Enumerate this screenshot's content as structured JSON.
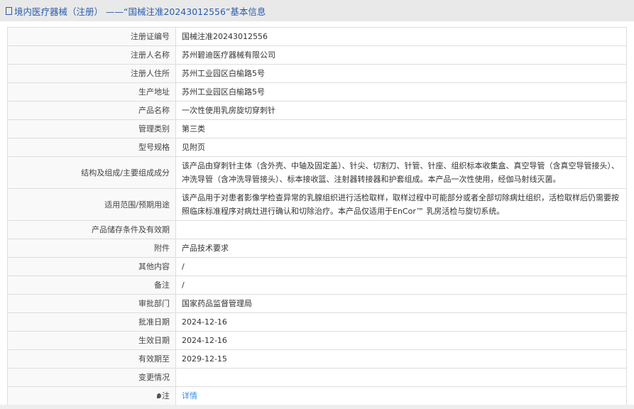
{
  "header": {
    "title": "境内医疗器械（注册） ——“国械注准20243012556”基本信息",
    "icon": "document-icon"
  },
  "rows": [
    {
      "label": "注册证编号",
      "value": "国械注准20243012556"
    },
    {
      "label": "注册人名称",
      "value": "苏州碧迪医疗器械有限公司"
    },
    {
      "label": "注册人住所",
      "value": "苏州工业园区白榆路5号"
    },
    {
      "label": "生产地址",
      "value": "苏州工业园区白榆路5号"
    },
    {
      "label": "产品名称",
      "value": "一次性使用乳房旋切穿刺针"
    },
    {
      "label": "管理类别",
      "value": "第三类"
    },
    {
      "label": "型号规格",
      "value": "见附页"
    },
    {
      "label": "结构及组成/主要组成成分",
      "value": "该产品由穿刺针主体（含外壳、中轴及固定盖）、针尖、切割刀、针管、针座、组织标本收集盒、真空导管（含真空导管接头）、冲洗导管（含冲洗导管接头）、标本接收篮、注射器转接器和护套组成。本产品一次性使用，经伽马射线灭菌。"
    },
    {
      "label": "适用范围/预期用途",
      "value": "该产品用于对患者影像学检查异常的乳腺组织进行活检取样，取样过程中可能部分或者全部切除病灶组织，活检取样后仍需要按照临床标准程序对病灶进行确认和切除治疗。本产品仅适用于EnCor™ 乳房活检与旋切系统。"
    },
    {
      "label": "产品储存条件及有效期",
      "value": ""
    },
    {
      "label": "附件",
      "value": "产品技术要求"
    },
    {
      "label": "其他内容",
      "value": "/"
    },
    {
      "label": "备注",
      "value": "/"
    },
    {
      "label": "审批部门",
      "value": "国家药品监督管理局"
    },
    {
      "label": "批准日期",
      "value": "2024-12-16"
    },
    {
      "label": "生效日期",
      "value": "2024-12-16"
    },
    {
      "label": "有效期至",
      "value": "2029-12-15"
    },
    {
      "label": "变更情况",
      "value": ""
    }
  ],
  "note": {
    "label": "注",
    "icon": "pin-icon",
    "link": "详情"
  }
}
